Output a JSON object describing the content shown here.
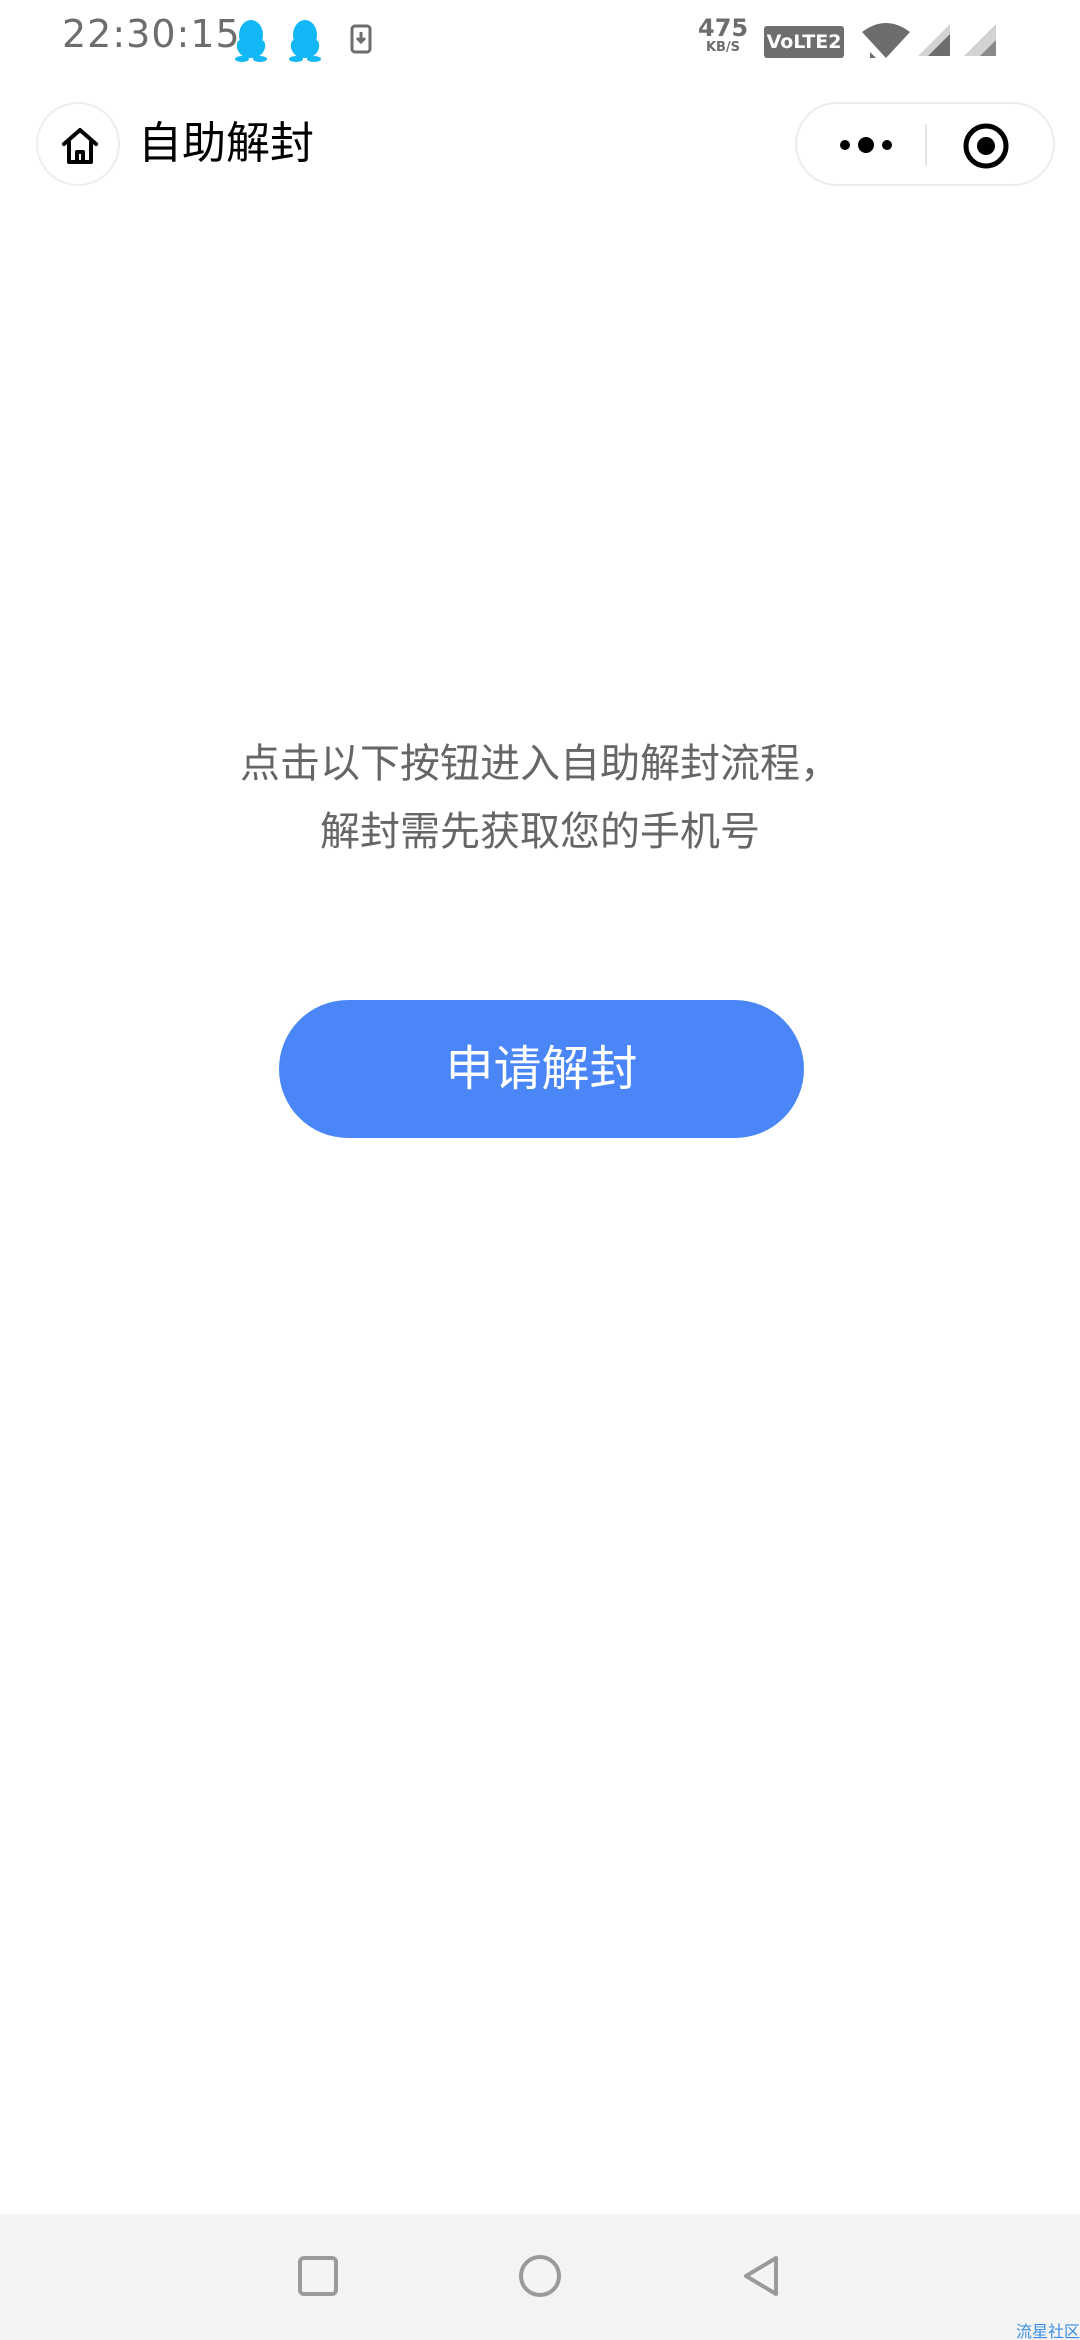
{
  "status_bar": {
    "time": "22:30:15",
    "net_speed_value": "475",
    "net_speed_unit": "KB/S",
    "volte_label": "VoLTE2",
    "icons": [
      "qq-icon",
      "qq-icon",
      "download-icon",
      "wifi-icon",
      "signal-icon",
      "signal-icon"
    ]
  },
  "header": {
    "title": "自助解封",
    "home_icon": "home-icon",
    "more_icon": "more-dots-icon",
    "close_icon": "target-close-icon"
  },
  "main": {
    "description_line1": "点击以下按钮进入自助解封流程，",
    "description_line2": "解封需先获取您的手机号",
    "apply_button_label": "申请解封"
  },
  "nav_bar": {
    "icons": [
      "recent-apps-icon",
      "home-circle-icon",
      "back-icon"
    ],
    "watermark": "流星社区"
  },
  "colors": {
    "primary_button": "#4a86f7",
    "qq_icon": "#12b7f5",
    "text_secondary": "#666666",
    "nav_bar_bg": "#f4f4f4"
  }
}
